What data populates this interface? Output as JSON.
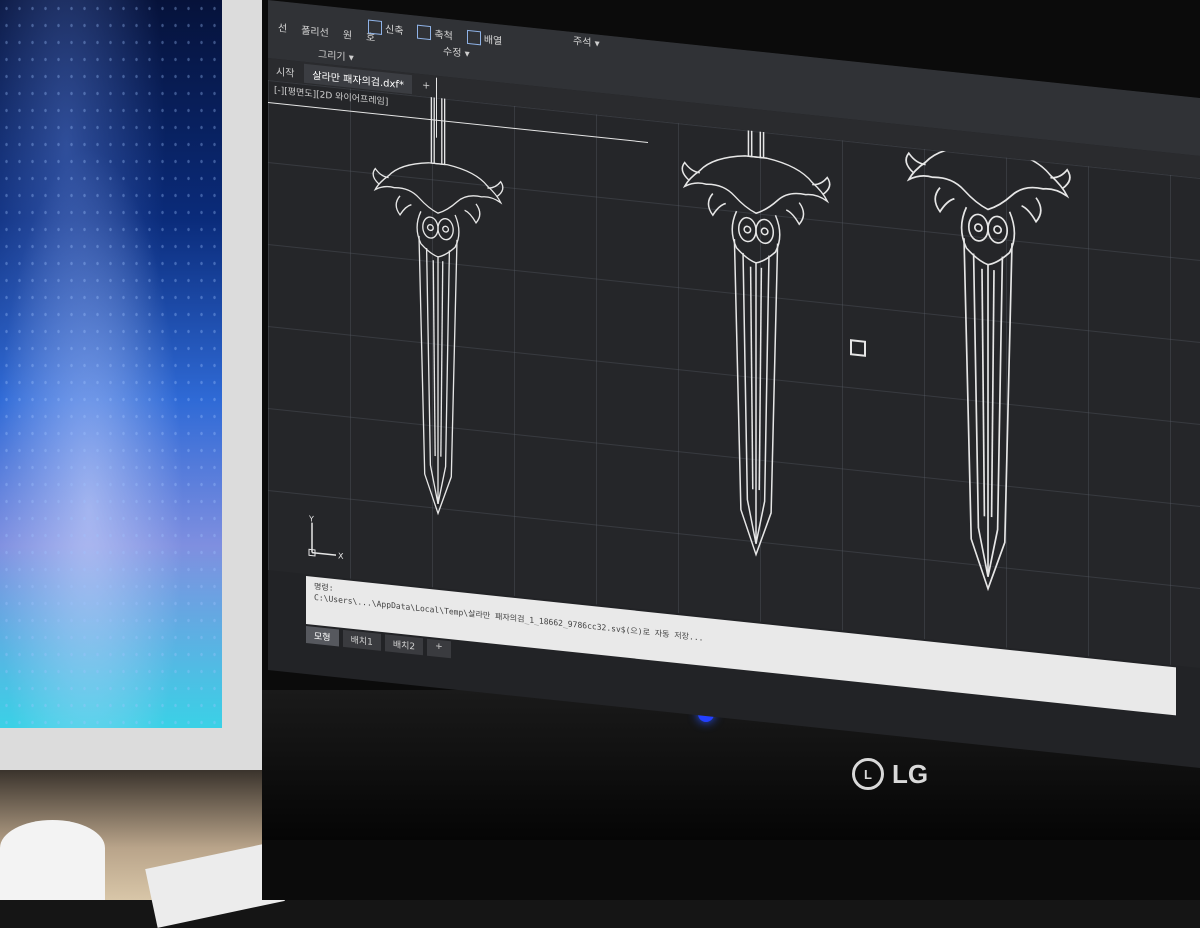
{
  "ribbon": {
    "row1": [
      "선",
      "폴리선",
      "원",
      "호"
    ],
    "row2": [
      {
        "label": "신축",
        "icon": "stretch-icon"
      },
      {
        "label": "축척",
        "icon": "scale-icon"
      },
      {
        "label": "배열",
        "icon": "array-icon"
      }
    ],
    "annotation_label": "주석",
    "draw_group": "그리기",
    "modify_group": "수정"
  },
  "tabs": {
    "start": "시작",
    "active_doc": "살라만 패자의검.dxf*",
    "add": "+"
  },
  "viewport": {
    "label": "[-][평면도][2D 와이어프레임]"
  },
  "command": {
    "history_label": "명령:",
    "message": "C:\\Users\\...\\AppData\\Local\\Temp\\살라만 패자의검_1_18662_9786cc32.sv$(으)로 자동 저장..."
  },
  "layout_tabs": [
    "모형",
    "배치1",
    "배치2"
  ],
  "add_layout": "+",
  "ucs": {
    "x": "X",
    "y": "Y"
  },
  "monitor": {
    "brand": "LG",
    "brand_mark": "L"
  },
  "colors": {
    "screen_bg": "#222326",
    "linework": "#e6e6e6",
    "ribbon_bg": "#303236"
  }
}
